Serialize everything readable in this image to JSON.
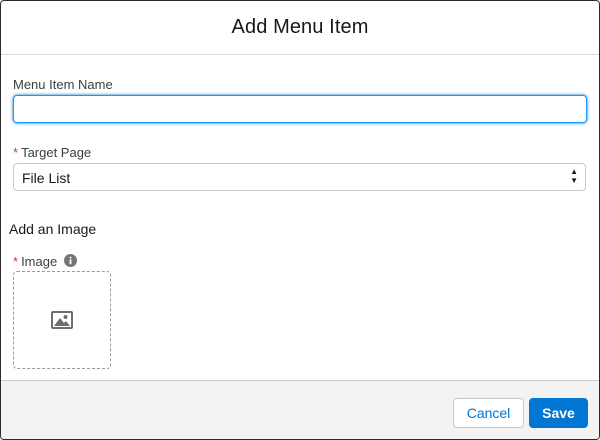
{
  "modal": {
    "title": "Add Menu Item"
  },
  "form": {
    "menu_item_name": {
      "label": "Menu Item Name",
      "value": "",
      "placeholder": ""
    },
    "target_page": {
      "required_marker": "*",
      "label": "Target Page",
      "selected": "File List"
    },
    "image_section": {
      "heading": "Add an Image"
    },
    "image": {
      "required_marker": "*",
      "label": "Image",
      "info_icon": "info-icon",
      "placeholder_icon": "image-icon"
    }
  },
  "footer": {
    "cancel_label": "Cancel",
    "save_label": "Save"
  },
  "colors": {
    "brand": "#0176d3",
    "required": "#c23934",
    "footer_bg": "#f3f3f3"
  }
}
